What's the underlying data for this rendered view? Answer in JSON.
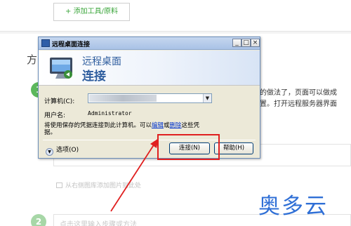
{
  "background": {
    "add_tool_label": "+ 添加工具/原料",
    "section_heading": "方",
    "step1_number": "1",
    "step1_text_line1": "的做法了，页面可以做成",
    "step1_text_line2": "置。打开远程服务器界面",
    "image_hint": "从右侧图库添加图片到此处",
    "step2_number": "2",
    "step2_placeholder": "点击这里输入步骤或方法",
    "watermark": "奥多云"
  },
  "dialog": {
    "title": "远程桌面连接",
    "banner_line1": "远程桌面",
    "banner_line2": "连接",
    "computer_label": "计算机(C):",
    "username_label": "用户名:",
    "username_value": "Administrator",
    "saved_text_before": "将使用保存的凭据连接到此计算机。可以",
    "edit_link": "编辑",
    "or_text": "或",
    "delete_link": "删除",
    "saved_text_after": "这些凭据。",
    "options_label": "选项(O)",
    "connect_label": "连接(N)",
    "help_label": "帮助(H)"
  },
  "colors": {
    "annotation_red": "#e01f1f",
    "watermark_blue": "#2f6fd6",
    "step_green": "#5cb85c"
  }
}
